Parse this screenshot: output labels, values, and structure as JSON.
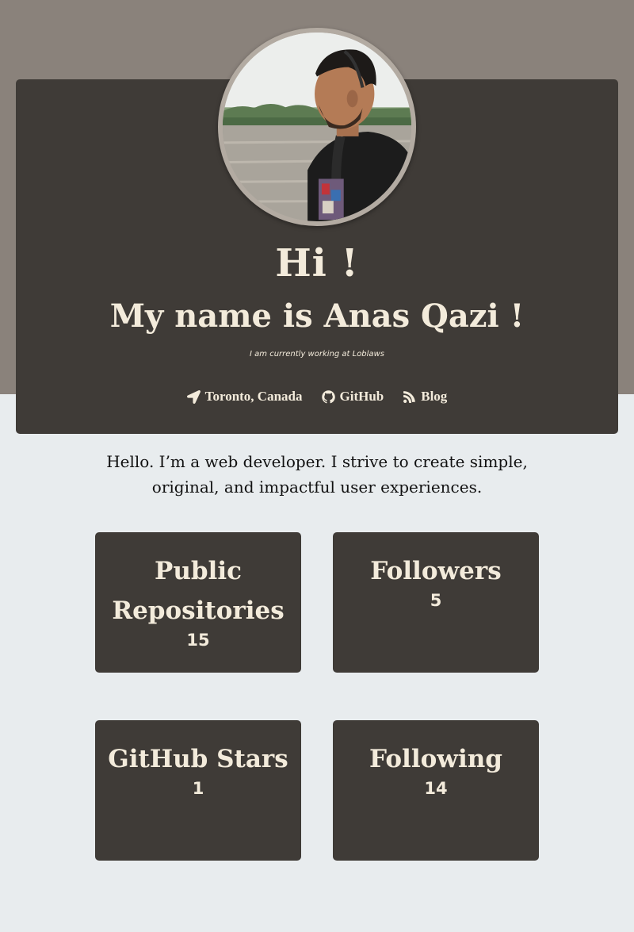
{
  "hero": {
    "greeting": "Hi !",
    "name": "My name is Anas Qazi !",
    "subtitle": "I am currently working at Loblaws",
    "links": {
      "location": "Toronto, Canada",
      "github": "GitHub",
      "blog": "Blog"
    }
  },
  "intro": "Hello. I’m a web developer. I strive to create simple, original, and impactful user experiences.",
  "stats": [
    {
      "title": "Public Repositories",
      "value": "15"
    },
    {
      "title": "Followers",
      "value": "5"
    },
    {
      "title": "GitHub Stars",
      "value": "1"
    },
    {
      "title": "Following",
      "value": "14"
    }
  ],
  "colors": {
    "top_band": "#8a827b",
    "panel": "#3f3b37",
    "text_light": "#f3ebdb",
    "page_bg": "#e8ecee"
  },
  "icons": [
    "location-arrow-icon",
    "github-icon",
    "rss-icon"
  ]
}
